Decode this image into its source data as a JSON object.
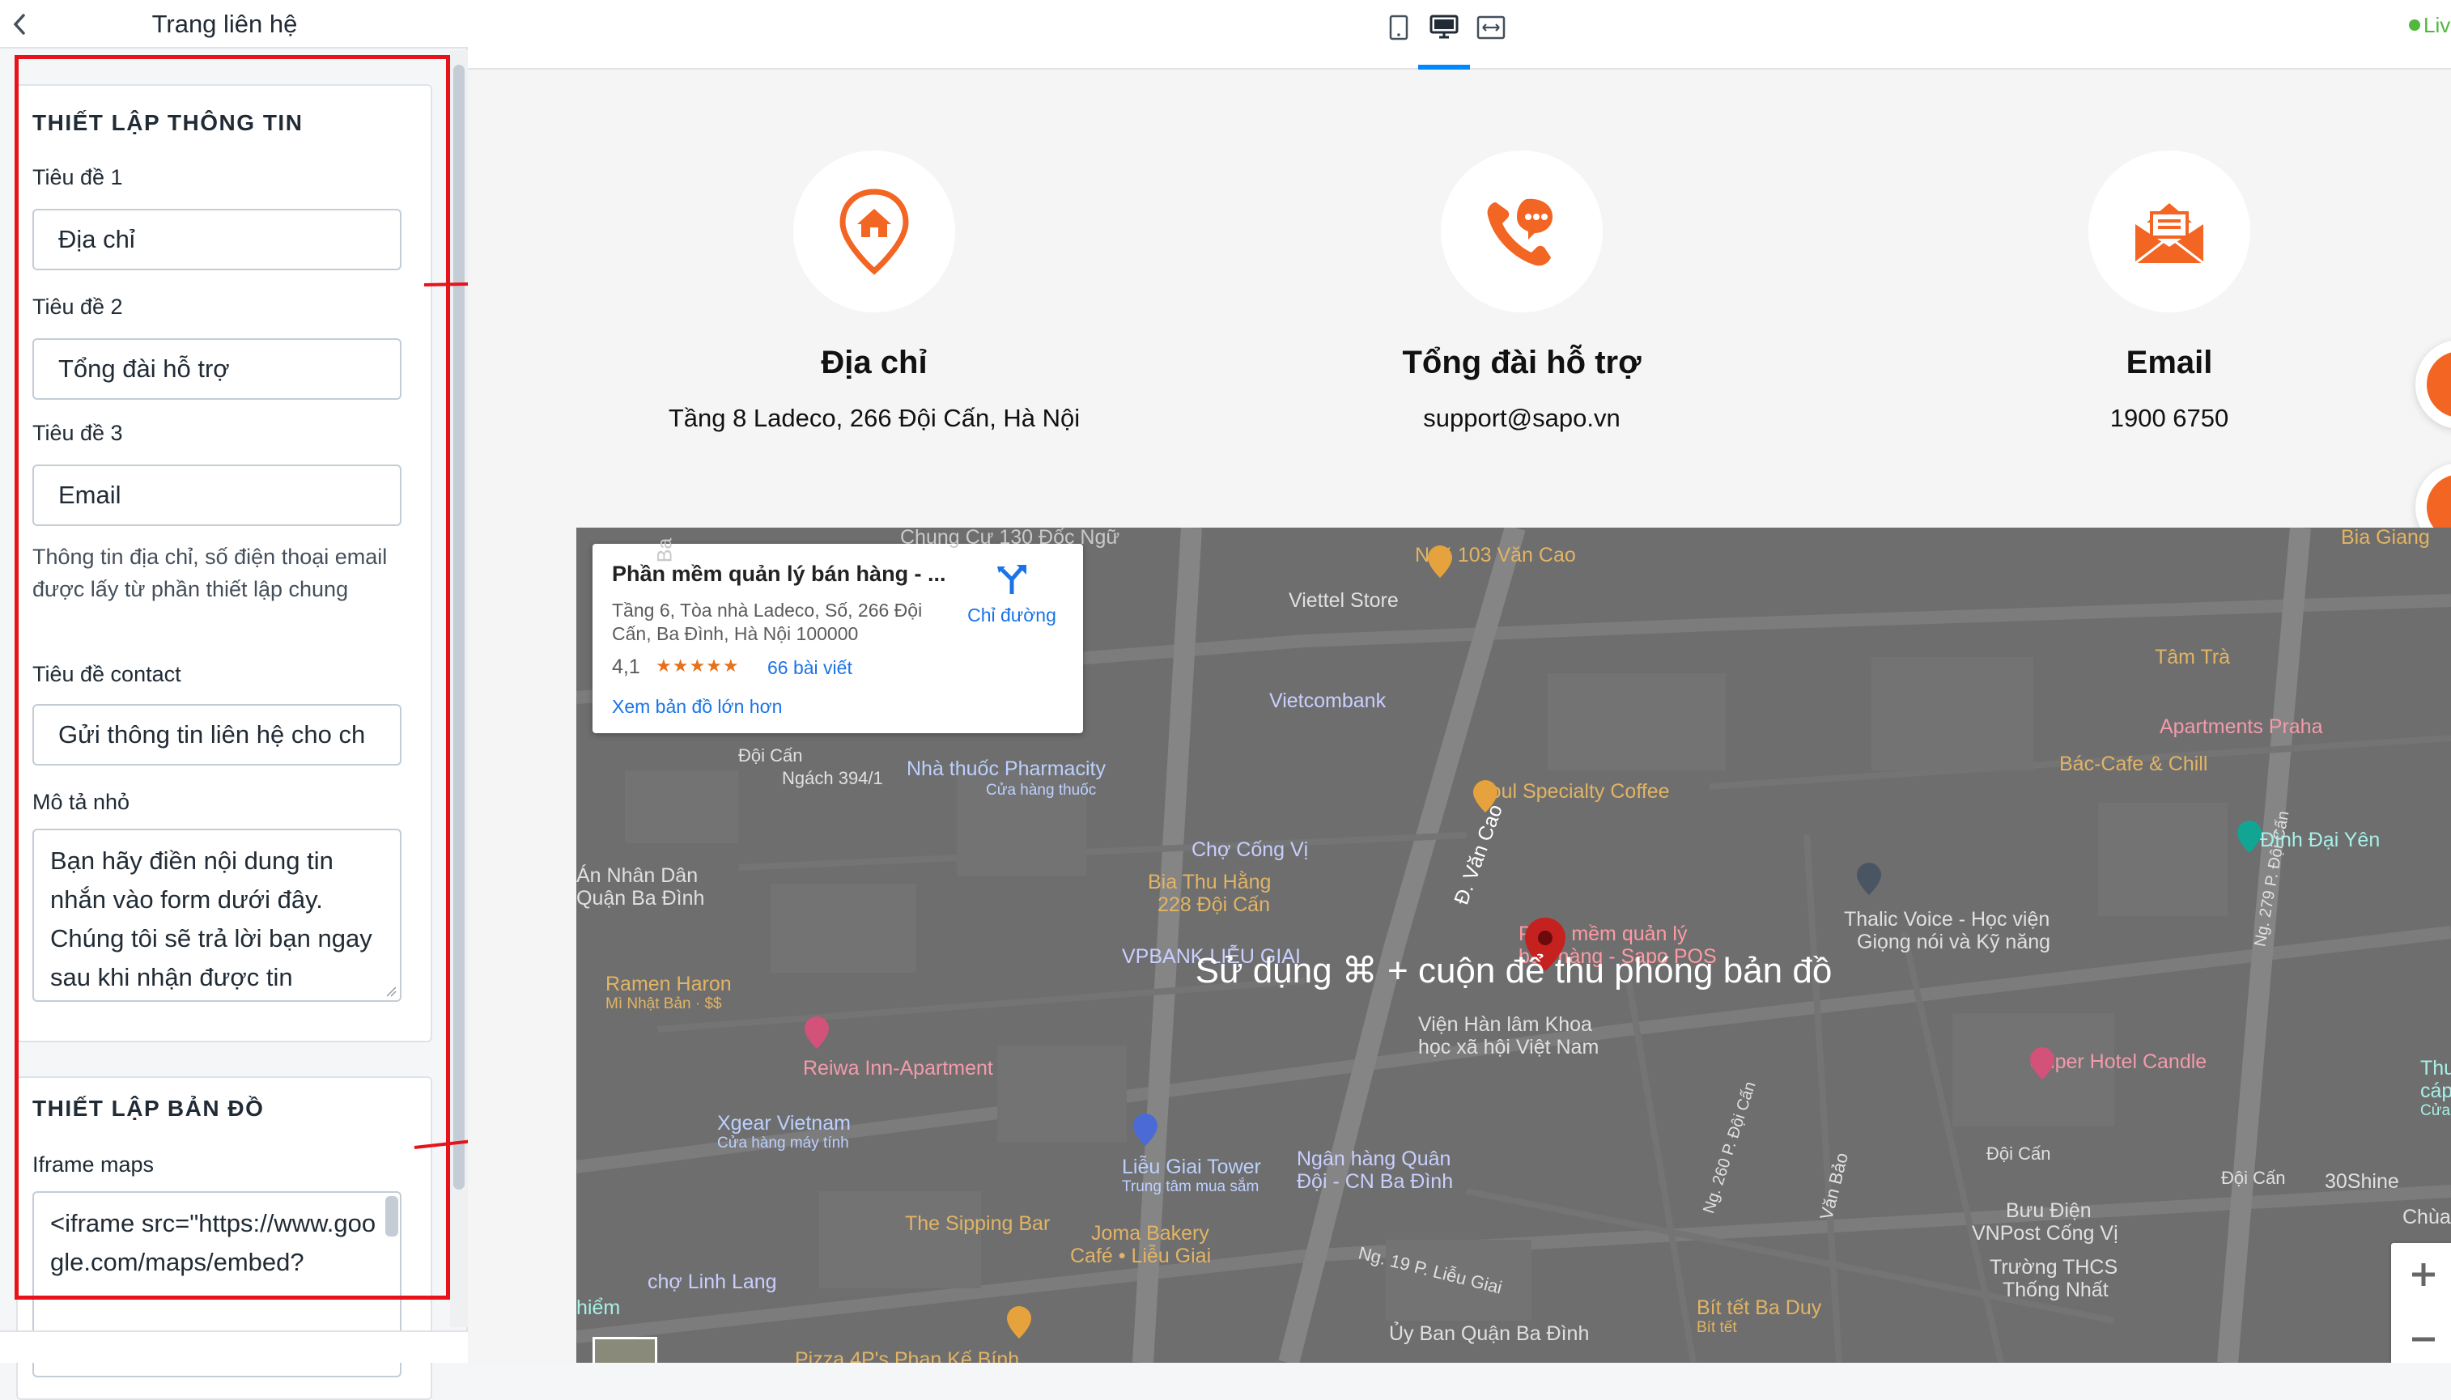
{
  "sidebar": {
    "title": "Trang liên hệ",
    "info_section": {
      "heading": "THIẾT LẬP THÔNG TIN",
      "title1_label": "Tiêu đề 1",
      "title1_value": "Địa chỉ",
      "title2_label": "Tiêu đề 2",
      "title2_value": "Tổng đài hỗ trợ",
      "title3_label": "Tiêu đề 3",
      "title3_value": "Email",
      "help_text": "Thông tin địa chỉ, số điện thoại email được lấy từ phần thiết lập chung",
      "contact_title_label": "Tiêu đề contact",
      "contact_title_value": "Gửi thông tin liên hệ cho ch",
      "description_label": "Mô tả nhỏ",
      "description_value": "Bạn hãy điền nội dung tin nhắn vào form dưới đây. Chúng tôi sẽ trả lời bạn ngay sau khi nhận được tin"
    },
    "map_section": {
      "heading": "THIẾT LẬP BẢN ĐỒ",
      "iframe_label": "Iframe maps",
      "iframe_value": "<iframe src=\"https://www.google.com/maps/embed?"
    }
  },
  "toolbar": {
    "devices": [
      "mobile-icon",
      "desktop-icon",
      "fullwidth-icon"
    ],
    "active_device": "desktop",
    "live_label": "Liv"
  },
  "contacts": [
    {
      "title": "Địa chỉ",
      "value": "Tầng 8 Ladeco, 266 Đội Cấn, Hà Nội",
      "icon": "home-pin-icon"
    },
    {
      "title": "Tổng đài hỗ trợ",
      "value": "support@sapo.vn",
      "icon": "phone-chat-icon"
    },
    {
      "title": "Email",
      "value": "1900 6750",
      "icon": "envelope-icon"
    }
  ],
  "colors": {
    "accent_orange": "#f26522",
    "highlight_red": "#e8131a",
    "link_blue": "#1a73e8"
  },
  "map": {
    "overlay_text": "Sử dụng ⌘ + cuộn để thu phóng bản đồ",
    "place_card": {
      "title": "Phần mềm quản lý bán hàng - ...",
      "address": "Tầng 6, Tòa nhà Ladeco, Số, 266 Đội Cấn, Ba Đình, Hà Nội 100000",
      "rating": "4,1",
      "stars": "★★★★★",
      "reviews": "66 bài viết",
      "bigger_map": "Xem bản đồ lớn hơn",
      "directions": "Chỉ đường"
    },
    "labels": {
      "chung_cu": "Chung Cư 130 Đốc Ngữ",
      "ngo103": "Ngõ 103 Văn Cao",
      "viettel": "Viettel Store",
      "bia_giang": "Bia Giang",
      "tam_tra": "Tâm Trà",
      "apartments": "Apartments Praha",
      "vietcombank": "Vietcombank",
      "doi_can_1": "Đội Cấn",
      "ngach": "Ngách 394/1",
      "nha_thuoc": "Nhà thuốc Pharmacity",
      "nha_thuoc_sub": "Cửa hàng thuốc",
      "soul": "Soul Specialty Coffee",
      "bac_cafe": "Bác-Cafe & Chill",
      "d_van_cao": "Đ. Văn Cao",
      "ng279": "Ng. 279 P. Đội Cấn",
      "dinh_dai_yen": "Đình Đại Yên",
      "an_nhan_dan": "Án Nhân Dân",
      "quan_ba_dinh": "Quận Ba Đình",
      "cho_cong_vi": "Chợ Cống Vị",
      "bia_thu_hang": "Bia Thu Hằng",
      "bia_thu_hang_2": "228 Đội Cấn",
      "vpbank": "VPBANK LIỄU GIAI",
      "sapo_pin_1": "Phần mềm quản lý",
      "sapo_pin_2": "bán hàng - Sapo POS",
      "thalic": "Thalic Voice - Học viện",
      "thalic_2": "Giọng nói và Kỹ năng",
      "ramen": "Ramen Haron",
      "ramen_sub": "Mì Nhật Bản · $$",
      "vien_han_lam": "Viện Hàn lâm Khoa",
      "vien_han_lam_2": "học xã hội Việt Nam",
      "reiwa": "Reiwa Inn-Apartment",
      "super_hotel": "Super Hotel Candle",
      "thu": "Thu",
      "cap": "cáp",
      "cua": "Cửa",
      "xgear": "Xgear Vietnam",
      "xgear_sub": "Cửa hàng máy tính",
      "lieu_giai_tower": "Liễu Giai Tower",
      "lieu_giai_sub": "Trung tâm mua sắm",
      "ngan_hang_quan_doi": "Ngân hàng Quân",
      "ngan_hang_2": "Đội - CN Ba Đình",
      "ng260": "Ng. 260 P. Đội Cấn",
      "van_bao": "Văn Bảo",
      "doi_can_2": "Đội Cấn",
      "doi_can_3": "Đội Cấn",
      "shine": "30Shine",
      "chua": "Chùa",
      "buu_dien": "Bưu Điện",
      "vnpost": "VNPost Cống Vị",
      "thcs": "Trường THCS",
      "thong_nhat": "Thống Nhất",
      "sipping": "The Sipping Bar",
      "joma": "Joma Bakery",
      "joma_2": "Café • Liễu Giai",
      "ng19": "Ng. 19 P. Liễu Giai",
      "cho_linh_lang": "chợ Linh Lang",
      "bit_tet": "Bít tết Ba Duy",
      "bit_tet_sub": "Bít tết",
      "uy_ban": "Ủy Ban Quận Ba Đình",
      "pizza": "Pizza 4P's Phan Kế Bính",
      "hiem": "hiểm",
      "ba": "Ba"
    }
  }
}
